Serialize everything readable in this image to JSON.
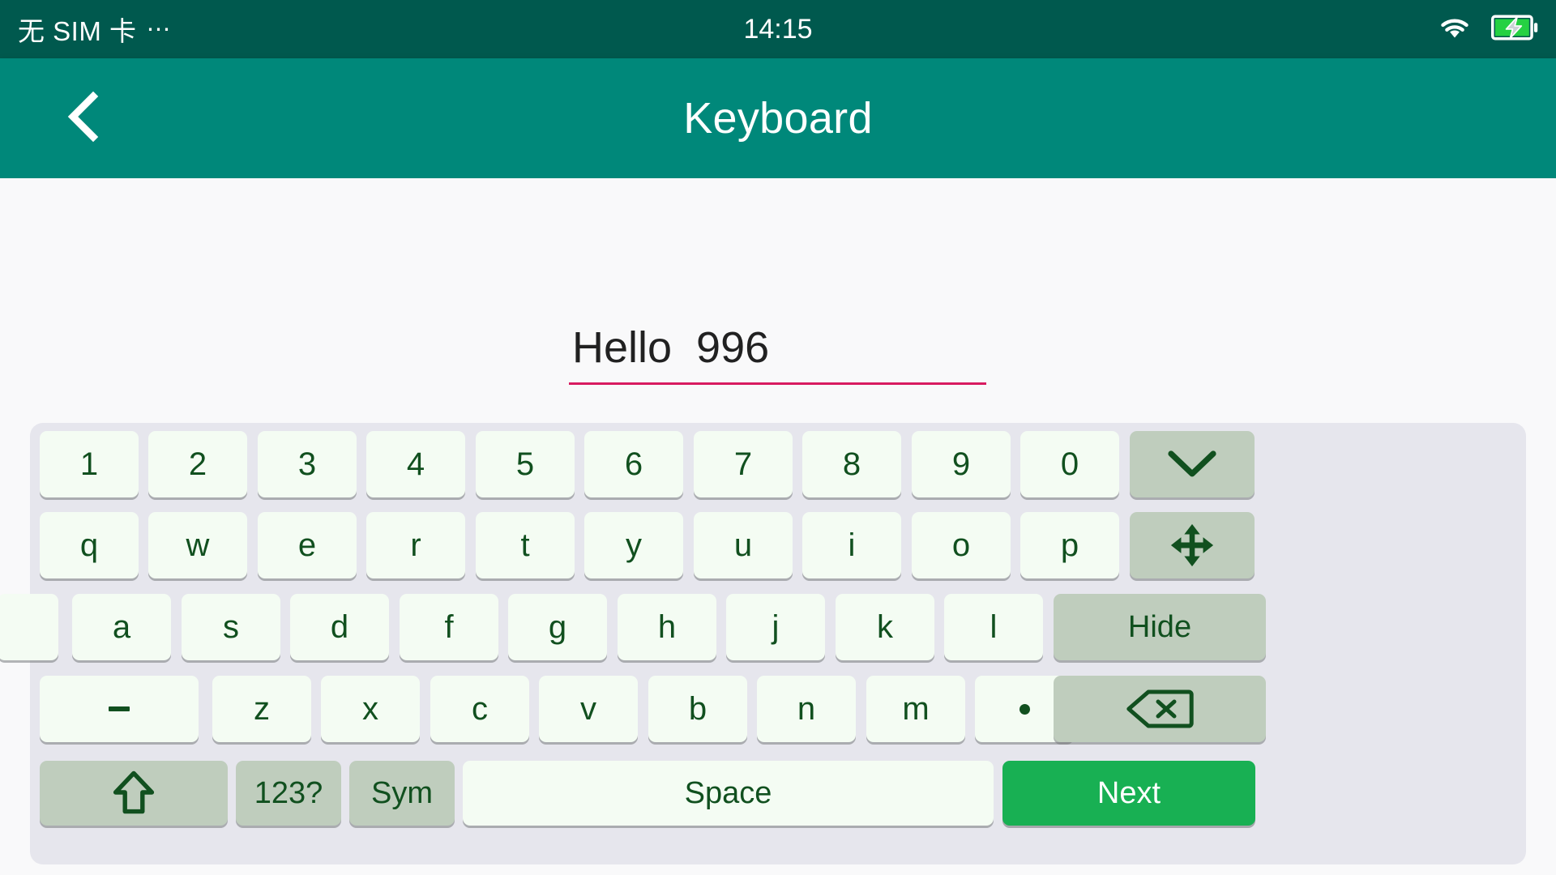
{
  "status_bar": {
    "carrier": "无 SIM 卡",
    "overflow": "⋯",
    "time": "14:15",
    "wifi_icon": "wifi-icon",
    "battery_icon": "battery-charging-icon",
    "background": "#00594e",
    "text_color": "#ffffff"
  },
  "app_bar": {
    "title": "Keyboard",
    "back_icon": "back-chevron-icon",
    "background": "#00887a"
  },
  "editor": {
    "value": "Hello  996",
    "placeholder": "",
    "underline_color": "#d81b60"
  },
  "keyboard": {
    "background": "#e6e6ed",
    "key_background": "#f4fcf3",
    "fn_key_background": "#bfcdbd",
    "accent_key_background": "#18b053",
    "key_text_color": "#11501f",
    "rows": [
      {
        "name": "row-digits",
        "keys": [
          {
            "label": "1",
            "type": "char"
          },
          {
            "label": "2",
            "type": "char"
          },
          {
            "label": "3",
            "type": "char"
          },
          {
            "label": "4",
            "type": "char"
          },
          {
            "label": "5",
            "type": "char"
          },
          {
            "label": "6",
            "type": "char"
          },
          {
            "label": "7",
            "type": "char"
          },
          {
            "label": "8",
            "type": "char"
          },
          {
            "label": "9",
            "type": "char"
          },
          {
            "label": "0",
            "type": "char"
          },
          {
            "label": "",
            "type": "fn",
            "icon": "chevron-down-icon"
          }
        ]
      },
      {
        "name": "row-qwerty",
        "keys": [
          {
            "label": "q",
            "type": "char"
          },
          {
            "label": "w",
            "type": "char"
          },
          {
            "label": "e",
            "type": "char"
          },
          {
            "label": "r",
            "type": "char"
          },
          {
            "label": "t",
            "type": "char"
          },
          {
            "label": "y",
            "type": "char"
          },
          {
            "label": "u",
            "type": "char"
          },
          {
            "label": "i",
            "type": "char"
          },
          {
            "label": "o",
            "type": "char"
          },
          {
            "label": "p",
            "type": "char"
          },
          {
            "label": "",
            "type": "fn",
            "icon": "move-arrows-icon"
          }
        ]
      },
      {
        "name": "row-asdf",
        "keys": [
          {
            "label": "",
            "type": "char",
            "partial": true
          },
          {
            "label": "a",
            "type": "char"
          },
          {
            "label": "s",
            "type": "char"
          },
          {
            "label": "d",
            "type": "char"
          },
          {
            "label": "f",
            "type": "char"
          },
          {
            "label": "g",
            "type": "char"
          },
          {
            "label": "h",
            "type": "char"
          },
          {
            "label": "j",
            "type": "char"
          },
          {
            "label": "k",
            "type": "char"
          },
          {
            "label": "l",
            "type": "char"
          },
          {
            "label": "Hide",
            "type": "fn"
          }
        ]
      },
      {
        "name": "row-zxcv",
        "keys": [
          {
            "label": "-",
            "type": "char",
            "icon": "dash-glyph"
          },
          {
            "label": "z",
            "type": "char"
          },
          {
            "label": "x",
            "type": "char"
          },
          {
            "label": "c",
            "type": "char"
          },
          {
            "label": "v",
            "type": "char"
          },
          {
            "label": "b",
            "type": "char"
          },
          {
            "label": "n",
            "type": "char"
          },
          {
            "label": "m",
            "type": "char"
          },
          {
            "label": "•",
            "type": "char",
            "icon": "dot-glyph"
          },
          {
            "label": "",
            "type": "fn",
            "icon": "backspace-icon"
          }
        ]
      },
      {
        "name": "row-bottom",
        "keys": [
          {
            "label": "",
            "type": "fn",
            "icon": "shift-up-arrow-icon"
          },
          {
            "label": "123?",
            "type": "fn"
          },
          {
            "label": "Sym",
            "type": "fn"
          },
          {
            "label": "Space",
            "type": "char"
          },
          {
            "label": "Next",
            "type": "accent"
          }
        ]
      }
    ]
  }
}
